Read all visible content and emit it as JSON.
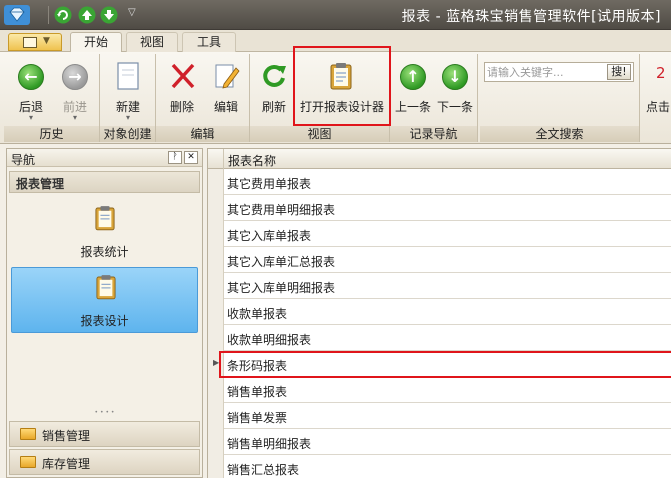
{
  "window": {
    "title": "报表 - 蓝格珠宝销售管理软件[试用版本]"
  },
  "tabs": [
    {
      "label": "开始",
      "active": true
    },
    {
      "label": "视图",
      "active": false
    },
    {
      "label": "工具",
      "active": false
    }
  ],
  "ribbon": {
    "groups": {
      "history": "历史",
      "object_create": "对象创建",
      "edit": "编辑",
      "view": "视图",
      "record_nav": "记录导航",
      "fulltext": "全文搜索"
    },
    "buttons": {
      "back": "后退",
      "forward": "前进",
      "new": "新建",
      "delete": "删除",
      "edit": "编辑",
      "refresh": "刷新",
      "open_designer": "打开报表设计器",
      "prev": "上一条",
      "next": "下一条"
    },
    "search": {
      "placeholder": "请输入关键字...",
      "button": "搜!"
    },
    "extra": {
      "number": "2",
      "text": "点击"
    }
  },
  "nav": {
    "title": "导航",
    "pin": "📌",
    "close": "✕",
    "group": "报表管理",
    "items": [
      {
        "label": "报表统计"
      },
      {
        "label": "报表设计"
      }
    ],
    "bottom": [
      {
        "label": "销售管理"
      },
      {
        "label": "库存管理"
      }
    ]
  },
  "list": {
    "column": "报表名称",
    "rows": [
      "其它费用单报表",
      "其它费用单明细报表",
      "其它入库单报表",
      "其它入库单汇总报表",
      "其它入库单明细报表",
      "收款单报表",
      "收款单明细报表",
      "条形码报表",
      "销售单报表",
      "销售单发票",
      "销售单明细报表",
      "销售汇总报表"
    ],
    "selected_index": 7
  },
  "colors": {
    "highlight": "#e0151b",
    "selected_nav": "#5eb4ee",
    "titlebar": "#4f4b45"
  }
}
